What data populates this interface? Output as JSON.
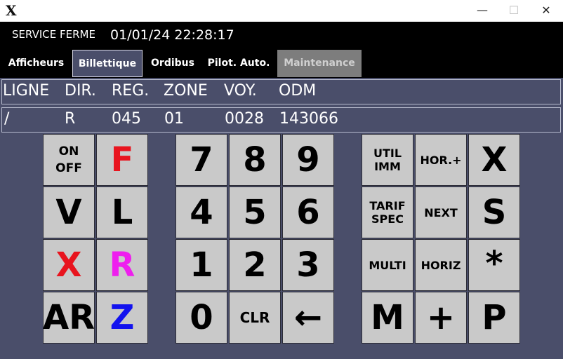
{
  "window": {
    "logo_icon": "x-logo-icon",
    "minimize": "—",
    "maximize": "☐",
    "close": "✕"
  },
  "header": {
    "status": "SERVICE FERME",
    "datetime": "01/01/24 22:28:17"
  },
  "tabs": [
    {
      "label": "Afficheurs",
      "state": "normal"
    },
    {
      "label": "Billettique",
      "state": "active"
    },
    {
      "label": "Ordibus",
      "state": "normal"
    },
    {
      "label": "Pilot. Auto.",
      "state": "normal"
    },
    {
      "label": "Maintenance",
      "state": "disabled"
    }
  ],
  "table": {
    "headers": [
      "LIGNE",
      "DIR.",
      "REG.",
      "ZONE",
      "VOY.",
      "ODM"
    ],
    "values": [
      "/",
      "R",
      "045",
      "01",
      "0028",
      "143066"
    ]
  },
  "keypad": {
    "left": [
      {
        "line1": "ON",
        "line2": "OFF"
      },
      {
        "label": "F",
        "color": "#e8141e"
      },
      {
        "label": "V"
      },
      {
        "label": "L"
      },
      {
        "label": "X",
        "color": "#e8141e"
      },
      {
        "label": "R",
        "color": "#ee1fee"
      },
      {
        "label": "AR"
      },
      {
        "label": "Z",
        "color": "#1212ee"
      }
    ],
    "numeric": [
      "7",
      "8",
      "9",
      "4",
      "5",
      "6",
      "1",
      "2",
      "3",
      "0",
      "CLR",
      "←"
    ],
    "right": [
      {
        "line1": "UTIL",
        "line2": "IMM"
      },
      {
        "label": "HOR.+"
      },
      {
        "label": "X"
      },
      {
        "line1": "TARIF",
        "line2": "SPEC"
      },
      {
        "label": "NEXT"
      },
      {
        "label": "S"
      },
      {
        "label": "MULTI"
      },
      {
        "label": "HORIZ"
      },
      {
        "label": "*"
      },
      {
        "label": "M"
      },
      {
        "label": "+"
      },
      {
        "label": "P"
      }
    ]
  },
  "colors": {
    "background": "#4a4e6a",
    "key": "#c9c9c9",
    "red": "#e8141e",
    "magenta": "#ee1fee",
    "blue": "#1212ee"
  }
}
